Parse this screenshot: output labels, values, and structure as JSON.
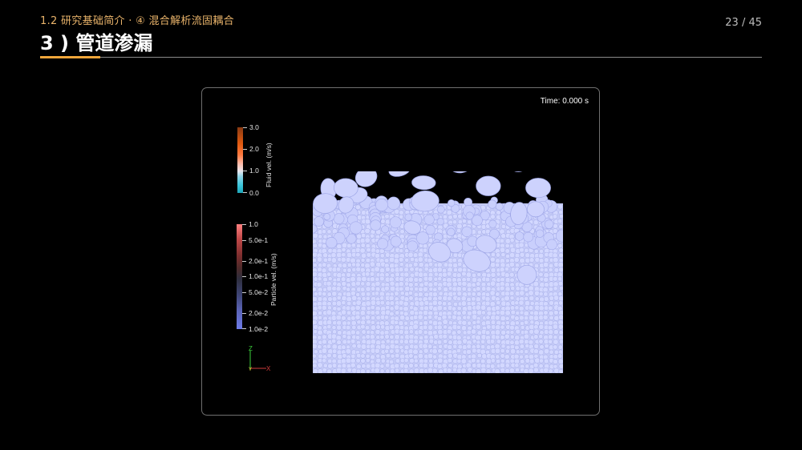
{
  "header": {
    "subtitle": "1.2 研究基础简介 · ④ 混合解析流固耦合",
    "title": "3 ) 管道渗漏",
    "page": "23 / 45"
  },
  "viewer": {
    "time_label": "Time: 0.000 s",
    "fluid_colorbar": {
      "title": "Fluid vel. (m/s)",
      "ticks": [
        "3.0",
        "2.0",
        "1.0",
        "0.0"
      ]
    },
    "particle_colorbar": {
      "title": "Particle vel. (m/s)",
      "ticks": [
        "1.0",
        "5.0e-1",
        "2.0e-1",
        "1.0e-1",
        "5.0e-2",
        "2.0e-2",
        "1.0e-2"
      ]
    },
    "axes": {
      "z": "Z",
      "y": "Y",
      "x": "X"
    }
  },
  "colors": {
    "accent": "#f0a63b",
    "subtitle": "#e9b36a",
    "particle": "#c9cffc"
  }
}
